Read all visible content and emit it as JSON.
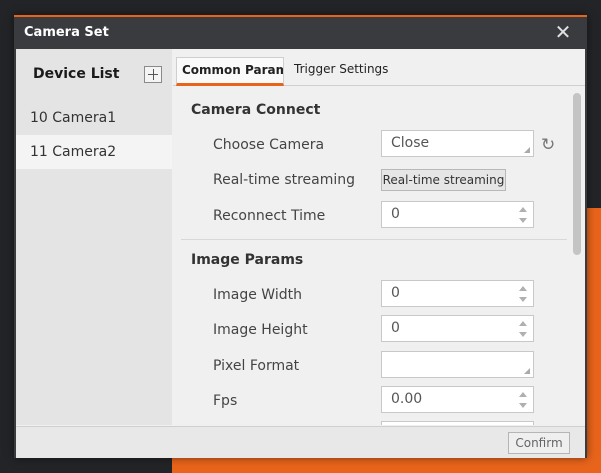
{
  "window": {
    "title": "Camera Set",
    "accent_color": "#e8641b"
  },
  "sidebar": {
    "title": "Device List",
    "items": [
      {
        "label": "10 Camera1"
      },
      {
        "label": "11 Camera2"
      }
    ]
  },
  "tabs": [
    {
      "label": "Common Params"
    },
    {
      "label": "Trigger Settings"
    }
  ],
  "camera_connect": {
    "title": "Camera Connect",
    "choose_camera": {
      "label": "Choose Camera",
      "value": "Close"
    },
    "realtime": {
      "label": "Real-time streaming",
      "button": "Real-time streaming"
    },
    "reconnect": {
      "label": "Reconnect Time",
      "value": "0"
    }
  },
  "image_params": {
    "title": "Image Params",
    "width": {
      "label": "Image Width",
      "value": "0"
    },
    "height": {
      "label": "Image Height",
      "value": "0"
    },
    "pixel_format": {
      "label": "Pixel Format",
      "value": ""
    },
    "fps": {
      "label": "Fps",
      "value": "0.00"
    }
  },
  "footer": {
    "confirm": "Confirm"
  }
}
